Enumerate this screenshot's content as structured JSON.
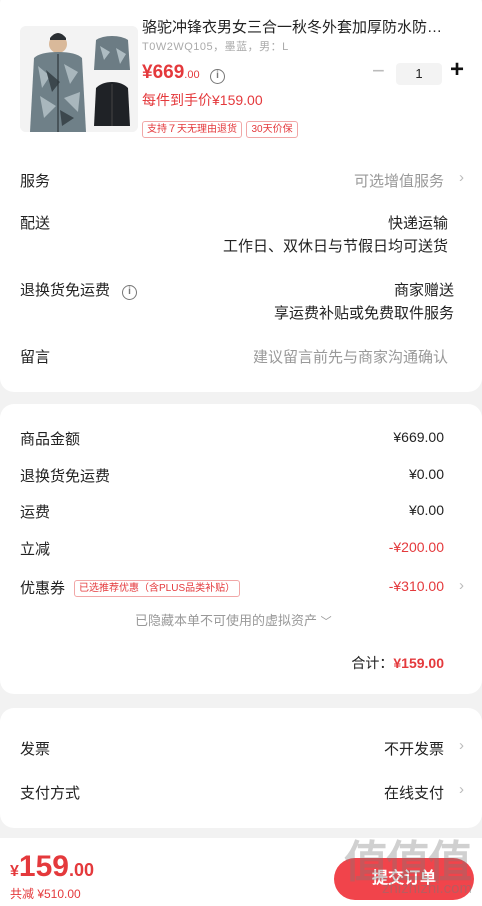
{
  "product": {
    "title": "骆驼冲锋衣男女三合一秋冬外套加厚防水防…",
    "spec": "T0W2WQ105，墨蓝，男：L",
    "price": "¥669",
    "price_decimal": ".00",
    "each_price": "每件到手价¥159.00",
    "tags": [
      "支持７天无理由退货",
      "30天价保"
    ],
    "quantity": "1",
    "minus_icon": "−",
    "plus_icon": "+"
  },
  "options": {
    "service_label": "服务",
    "service_value": "可选增值服务",
    "delivery_label": "配送",
    "delivery_value1": "快递运输",
    "delivery_value2": "工作日、双休日与节假日均可送货",
    "return_label": "退换货免运费",
    "return_value1": "商家赠送",
    "return_value2": "享运费补贴或免费取件服务",
    "message_label": "留言",
    "message_placeholder": "建议留言前先与商家沟通确认"
  },
  "summary": {
    "goods_label": "商品金额",
    "goods_value": "¥669.00",
    "return_fee_label": "退换货免运费",
    "return_fee_value": "¥0.00",
    "shipping_label": "运费",
    "shipping_value": "¥0.00",
    "discount_label": "立减",
    "discount_value": "-¥200.00",
    "coupon_label": "优惠券",
    "coupon_tag": "已选推荐优惠（含PLUS品类补贴）",
    "coupon_value": "-¥310.00",
    "hidden_assets": "已隐藏本单不可使用的虚拟资产",
    "total_label": "合计：",
    "total_value": "¥159.00"
  },
  "payment": {
    "invoice_label": "发票",
    "invoice_value": "不开发票",
    "pay_label": "支付方式",
    "pay_value": "在线支付"
  },
  "footer": {
    "price_symbol": "¥",
    "price": "159",
    "price_decimal": ".00",
    "saved": "共减 ¥510.00",
    "submit_label": "提交订单",
    "watermark": "值值值",
    "watermark_url": "zhizhizhi.com"
  },
  "colors": {
    "accent": "#e4393c",
    "submit": "#f1444b"
  },
  "icons": {
    "chevron": "›",
    "info": "i",
    "caret": "﹀"
  }
}
